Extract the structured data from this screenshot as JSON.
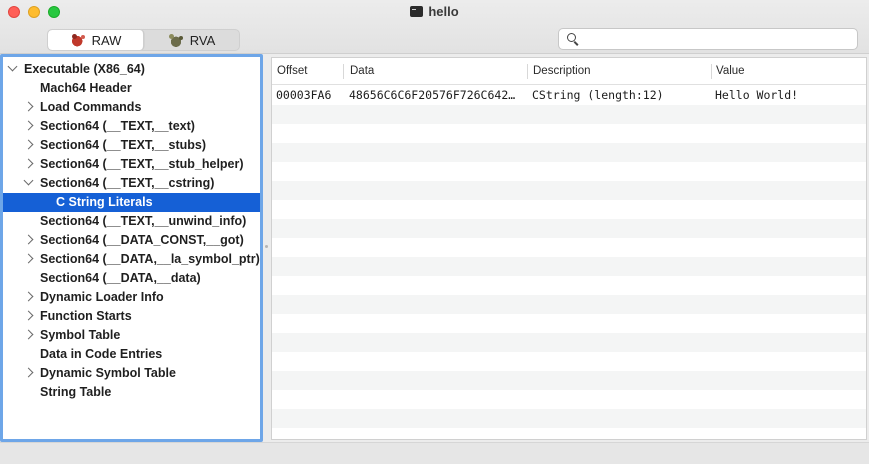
{
  "window": {
    "title": "hello",
    "title_icon": "terminal-icon"
  },
  "toolbar": {
    "mode_raw_label": "RAW",
    "mode_rva_label": "RVA",
    "mode_selected": "RAW",
    "search_placeholder": "",
    "search_value": ""
  },
  "tree": {
    "items": [
      {
        "label": "Executable  (X86_64)",
        "level": 0,
        "disclosure": "expanded"
      },
      {
        "label": "Mach64 Header",
        "level": 1,
        "disclosure": "none"
      },
      {
        "label": "Load Commands",
        "level": 1,
        "disclosure": "collapsed"
      },
      {
        "label": "Section64 (__TEXT,__text)",
        "level": 1,
        "disclosure": "collapsed"
      },
      {
        "label": "Section64 (__TEXT,__stubs)",
        "level": 1,
        "disclosure": "collapsed"
      },
      {
        "label": "Section64 (__TEXT,__stub_helper)",
        "level": 1,
        "disclosure": "collapsed"
      },
      {
        "label": "Section64 (__TEXT,__cstring)",
        "level": 1,
        "disclosure": "expanded"
      },
      {
        "label": "C String Literals",
        "level": 2,
        "disclosure": "none",
        "selected": true
      },
      {
        "label": "Section64 (__TEXT,__unwind_info)",
        "level": 1,
        "disclosure": "none"
      },
      {
        "label": "Section64 (__DATA_CONST,__got)",
        "level": 1,
        "disclosure": "collapsed"
      },
      {
        "label": "Section64 (__DATA,__la_symbol_ptr)",
        "level": 1,
        "disclosure": "collapsed"
      },
      {
        "label": "Section64 (__DATA,__data)",
        "level": 1,
        "disclosure": "none"
      },
      {
        "label": "Dynamic Loader Info",
        "level": 1,
        "disclosure": "collapsed"
      },
      {
        "label": "Function Starts",
        "level": 1,
        "disclosure": "collapsed"
      },
      {
        "label": "Symbol Table",
        "level": 1,
        "disclosure": "collapsed"
      },
      {
        "label": "Data in Code Entries",
        "level": 1,
        "disclosure": "none"
      },
      {
        "label": "Dynamic Symbol Table",
        "level": 1,
        "disclosure": "collapsed"
      },
      {
        "label": "String Table",
        "level": 1,
        "disclosure": "none"
      }
    ]
  },
  "table": {
    "columns": [
      "Offset",
      "Data",
      "Description",
      "Value"
    ],
    "rows": [
      {
        "offset": "00003FA6",
        "data": "48656C6C6F20576F726C642…",
        "description": "CString (length:12)",
        "value": "Hello World!"
      }
    ]
  },
  "colors": {
    "selection": "#1560d6",
    "focus_ring": "#6ea6e8",
    "row_alt": "#f4f5f5"
  }
}
